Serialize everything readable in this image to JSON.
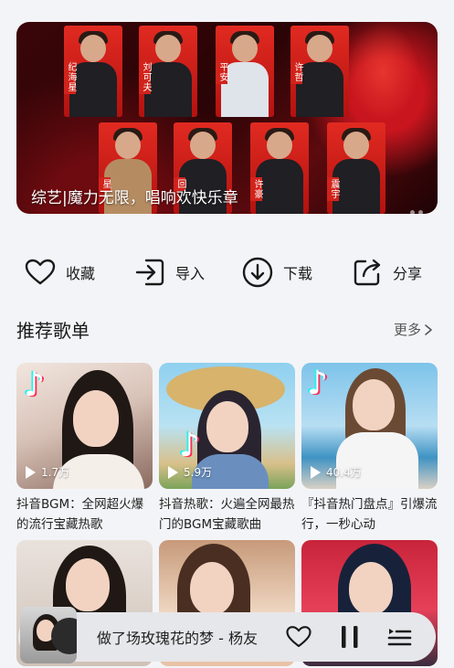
{
  "banner": {
    "caption": "综艺|魔力无限，唱响欢快乐章",
    "name_tags": [
      "纪海星",
      "刘可夫",
      "平安",
      "许哲",
      "星",
      "回",
      "许豪",
      "震宇"
    ]
  },
  "actions": [
    {
      "label": "收藏",
      "icon": "heart-icon"
    },
    {
      "label": "导入",
      "icon": "import-icon"
    },
    {
      "label": "下载",
      "icon": "download-icon"
    },
    {
      "label": "分享",
      "icon": "share-icon"
    }
  ],
  "section": {
    "title": "推荐歌单",
    "more": "更多"
  },
  "playlists": [
    {
      "plays": "1.7万",
      "title": "抖音BGM：全网超火爆的流行宝藏热歌"
    },
    {
      "plays": "5.9万",
      "title": "抖音热歌：火遍全网最热门的BGM宝藏歌曲"
    },
    {
      "plays": "40.4万",
      "title": "『抖音热门盘点』引爆流行，一秒心动"
    },
    {
      "plays": "",
      "title": ""
    },
    {
      "plays": "",
      "title": ""
    },
    {
      "plays": "",
      "title": ""
    }
  ],
  "player": {
    "song": "做了场玫瑰花的梦 - 杨友"
  }
}
